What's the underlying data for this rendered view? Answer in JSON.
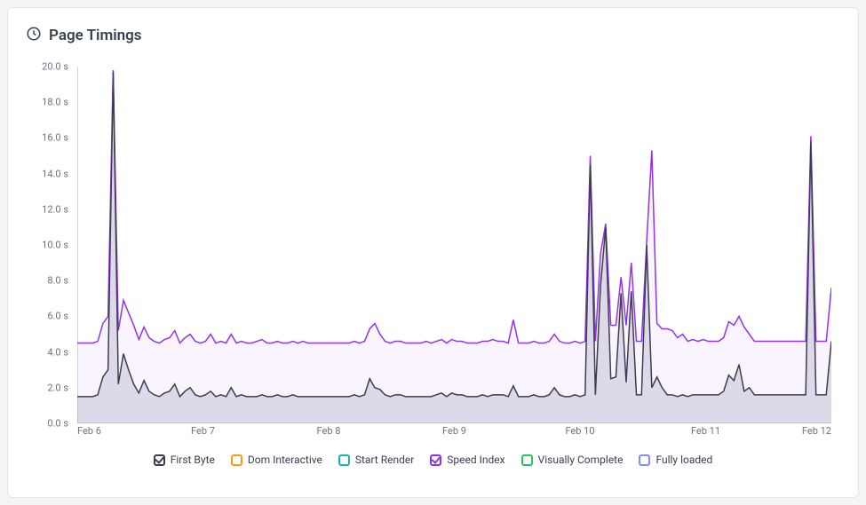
{
  "header": {
    "title": "Page Timings"
  },
  "chart_data": {
    "type": "area",
    "xlabel": "",
    "ylabel": "",
    "ylim": [
      0,
      20
    ],
    "x_categories": [
      "Feb 6",
      "Feb 7",
      "Feb 8",
      "Feb 9",
      "Feb 10",
      "Feb 11",
      "Feb 12"
    ],
    "y_ticks": [
      0,
      2,
      4,
      6,
      8,
      10,
      12,
      14,
      16,
      18,
      20
    ],
    "y_tick_labels": [
      "0.0 s",
      "2.0 s",
      "4.0 s",
      "6.0 s",
      "8.0 s",
      "10.0 s",
      "12.0 s",
      "14.0 s",
      "16.0 s",
      "18.0 s",
      "20.0 s"
    ],
    "series": [
      {
        "name": "First Byte",
        "color": "#3d3d4f",
        "fill": "#8d86a8",
        "visible": true,
        "values": [
          1.5,
          1.5,
          1.5,
          1.5,
          1.6,
          2.6,
          3.0,
          19.7,
          2.2,
          3.9,
          3.0,
          2.2,
          1.7,
          2.4,
          1.8,
          1.6,
          1.5,
          1.7,
          1.8,
          2.2,
          1.5,
          1.8,
          2.0,
          1.6,
          1.5,
          1.6,
          1.8,
          1.5,
          1.6,
          1.5,
          2.0,
          1.5,
          1.6,
          1.5,
          1.5,
          1.5,
          1.6,
          1.5,
          1.5,
          1.6,
          1.5,
          1.5,
          1.6,
          1.5,
          1.5,
          1.5,
          1.5,
          1.5,
          1.5,
          1.5,
          1.5,
          1.5,
          1.5,
          1.5,
          1.6,
          1.5,
          1.6,
          2.5,
          2.0,
          1.9,
          1.6,
          1.5,
          1.6,
          1.6,
          1.5,
          1.5,
          1.5,
          1.5,
          1.5,
          1.5,
          1.6,
          1.7,
          1.5,
          1.7,
          1.6,
          1.6,
          1.5,
          1.5,
          1.5,
          1.6,
          1.5,
          1.6,
          1.6,
          1.6,
          1.5,
          2.1,
          1.5,
          1.5,
          1.5,
          1.6,
          1.5,
          1.5,
          1.6,
          2.0,
          1.6,
          1.5,
          1.5,
          1.6,
          1.5,
          1.6,
          14.5,
          1.6,
          7.7,
          11.0,
          2.5,
          2.6,
          7.3,
          2.3,
          7.4,
          1.6,
          1.6,
          10.0,
          2.0,
          2.6,
          2.0,
          1.6,
          1.6,
          1.5,
          1.6,
          1.5,
          1.6,
          1.6,
          1.6,
          1.6,
          1.6,
          1.6,
          1.8,
          2.7,
          2.4,
          3.3,
          1.8,
          2.0,
          1.6,
          1.6,
          1.6,
          1.6,
          1.6,
          1.6,
          1.6,
          1.6,
          1.6,
          1.6,
          1.6,
          15.8,
          1.6,
          1.6,
          1.6,
          4.6
        ]
      },
      {
        "name": "Dom Interactive",
        "color": "#f59e0b",
        "fill": "#f59e0b",
        "visible": false,
        "values": []
      },
      {
        "name": "Start Render",
        "color": "#14b8a6",
        "fill": "#14b8a6",
        "visible": false,
        "values": []
      },
      {
        "name": "Speed Index",
        "color": "#9333ea",
        "fill": "#e9d5ff",
        "visible": true,
        "values": [
          4.5,
          4.5,
          4.5,
          4.5,
          4.6,
          5.6,
          6.0,
          19.8,
          5.2,
          6.9,
          6.2,
          5.5,
          4.7,
          5.4,
          4.8,
          4.6,
          4.5,
          4.7,
          4.8,
          5.2,
          4.5,
          4.8,
          5.0,
          4.6,
          4.5,
          4.6,
          5.0,
          4.5,
          4.6,
          4.5,
          5.0,
          4.5,
          4.6,
          4.5,
          4.5,
          4.6,
          4.7,
          4.5,
          4.5,
          4.6,
          4.5,
          4.5,
          4.6,
          4.5,
          4.6,
          4.5,
          4.5,
          4.5,
          4.5,
          4.5,
          4.5,
          4.5,
          4.5,
          4.5,
          4.6,
          4.5,
          4.6,
          5.3,
          5.6,
          5.0,
          4.6,
          4.5,
          4.6,
          4.6,
          4.5,
          4.5,
          4.5,
          4.5,
          4.6,
          4.5,
          4.6,
          4.7,
          4.5,
          4.7,
          4.6,
          4.6,
          4.5,
          4.5,
          4.5,
          4.6,
          4.6,
          4.7,
          4.6,
          4.6,
          4.5,
          5.8,
          4.5,
          4.5,
          4.5,
          4.6,
          4.5,
          4.5,
          4.6,
          5.0,
          4.6,
          4.5,
          4.5,
          4.6,
          4.5,
          4.6,
          15.0,
          4.6,
          9.5,
          11.2,
          5.5,
          5.5,
          8.2,
          5.5,
          9.0,
          4.6,
          4.6,
          10.2,
          15.3,
          5.6,
          5.3,
          5.3,
          5.2,
          4.8,
          5.0,
          4.6,
          4.7,
          4.6,
          4.7,
          4.6,
          4.6,
          4.6,
          4.8,
          5.7,
          5.5,
          6.0,
          5.4,
          5.0,
          4.6,
          4.6,
          4.6,
          4.6,
          4.6,
          4.6,
          4.6,
          4.6,
          4.6,
          4.6,
          4.6,
          16.1,
          4.6,
          4.6,
          4.6,
          7.6
        ]
      },
      {
        "name": "Visually Complete",
        "color": "#22c55e",
        "fill": "#22c55e",
        "visible": false,
        "values": []
      },
      {
        "name": "Fully loaded",
        "color": "#818cf8",
        "fill": "#818cf8",
        "visible": false,
        "values": []
      }
    ],
    "legend": {
      "position": "bottom"
    }
  }
}
